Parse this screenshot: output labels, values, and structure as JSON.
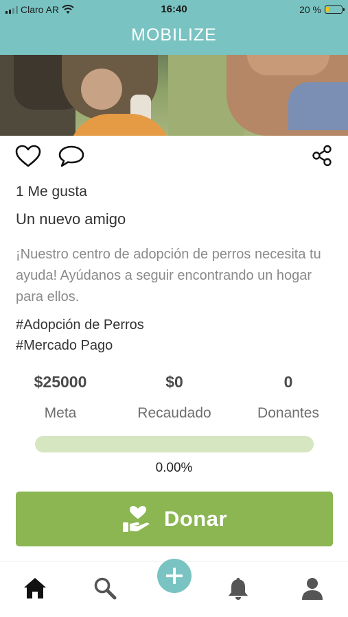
{
  "status_bar": {
    "carrier": "Claro AR",
    "time": "16:40",
    "battery": "20 %",
    "battery_level": 0.2,
    "signal_bars": 2,
    "icons": [
      "signal-icon",
      "wifi-icon",
      "battery-icon"
    ]
  },
  "header": {
    "brand": "MOBILIZE"
  },
  "hero": {
    "description": "dog photo banner"
  },
  "actions": {
    "icons": [
      "heart-icon",
      "comment-icon",
      "share-icon"
    ]
  },
  "post": {
    "likes": "1 Me gusta",
    "title": "Un nuevo amigo",
    "description": "¡Nuestro centro de adopción de perros necesita tu ayuda! Ayúdanos a seguir encontrando un hogar para ellos.",
    "tags": [
      "#Adopción de Perros",
      "#Mercado Pago"
    ]
  },
  "stats": [
    {
      "value": "$25000",
      "label": "Meta"
    },
    {
      "value": "$0",
      "label": "Recaudado"
    },
    {
      "value": "0",
      "label": "Donantes"
    }
  ],
  "progress": {
    "fraction": 0.0,
    "label": "0.00%"
  },
  "donate_button": {
    "label": "Donar",
    "icon": "donate-hand-heart-icon"
  },
  "tabbar": {
    "items": [
      "home-icon",
      "search-icon",
      "add-icon",
      "bell-icon",
      "profile-icon"
    ]
  },
  "colors": {
    "teal": "#79c4c2",
    "green": "#8bb652",
    "progress_bg": "#d5e6c0"
  }
}
